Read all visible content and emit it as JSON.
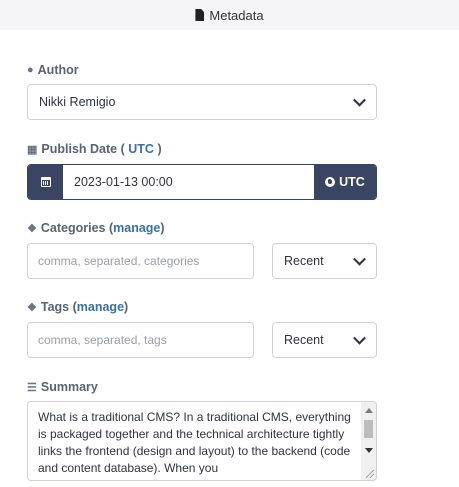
{
  "header": {
    "title": "Metadata",
    "icon": "file-icon"
  },
  "author": {
    "label": "Author",
    "icon": "user-icon",
    "value": "Nikki Remigio"
  },
  "publish_date": {
    "label": "Publish Date",
    "paren_open": "(",
    "utc_link": "UTC",
    "paren_close": ")",
    "icon": "calendar-icon",
    "value": "2023-01-13 00:00",
    "utc_button": "UTC"
  },
  "categories": {
    "label": "Categories",
    "paren_open": "(",
    "manage_link": "manage",
    "paren_close": ")",
    "icon": "tags-icon",
    "placeholder": "comma, separated, categories",
    "sort_value": "Recent"
  },
  "tags": {
    "label": "Tags",
    "paren_open": "(",
    "manage_link": "manage",
    "paren_close": ")",
    "icon": "tags-icon",
    "placeholder": "comma, separated, tags",
    "sort_value": "Recent"
  },
  "summary": {
    "label": "Summary",
    "icon": "list-icon",
    "text": "What is a traditional CMS? In a traditional CMS, everything is packaged together and the technical architecture tightly links the frontend (design and layout) to the backend (code and content database). When you"
  },
  "colors": {
    "accent": "#3a4563",
    "link": "#3a6fa8"
  }
}
